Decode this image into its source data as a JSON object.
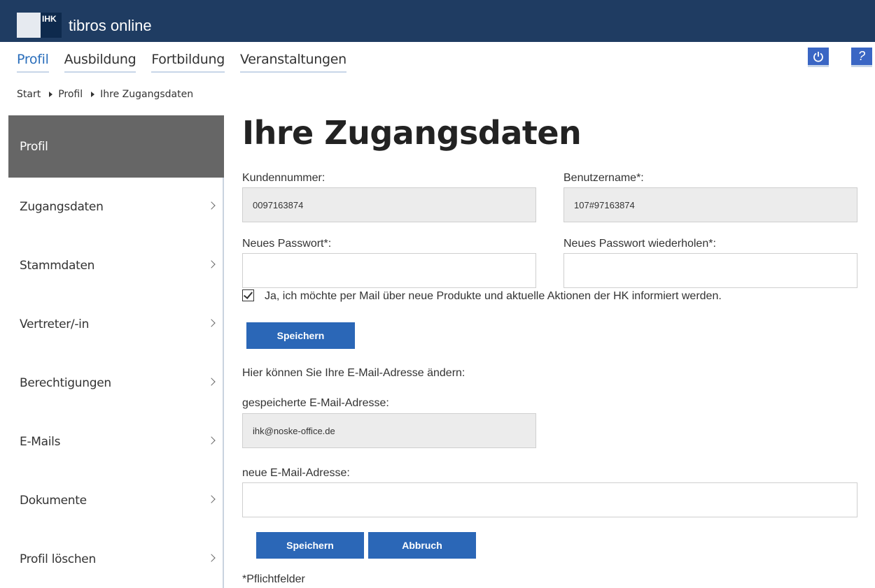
{
  "header": {
    "logo_text": "IHK",
    "app_title": "tibros online"
  },
  "nav": {
    "items": [
      {
        "label": "Profil",
        "active": true
      },
      {
        "label": "Ausbildung"
      },
      {
        "label": "Fortbildung"
      },
      {
        "label": "Veranstaltungen"
      }
    ],
    "help_label": "?"
  },
  "breadcrumb": [
    "Start",
    "Profil",
    "Ihre Zugangsdaten"
  ],
  "sidebar": {
    "items": [
      {
        "label": "Profil",
        "active": true
      },
      {
        "label": "Zugangsdaten"
      },
      {
        "label": "Stammdaten"
      },
      {
        "label": "Vertreter/-in"
      },
      {
        "label": "Berechtigungen"
      },
      {
        "label": "E-Mails"
      },
      {
        "label": "Dokumente"
      },
      {
        "label": "Profil löschen"
      }
    ]
  },
  "content": {
    "title": "Ihre Zugangsdaten",
    "kundennummer_label": "Kundennummer:",
    "kundennummer_value": "0097163874",
    "benutzername_label": "Benutzername*:",
    "benutzername_value": "107#97163874",
    "password_label": "Neues Passwort*:",
    "password_value": "",
    "password_repeat_label": "Neues Passwort wiederholen*:",
    "password_repeat_value": "",
    "newsletter_checked": true,
    "newsletter_label": "Ja, ich möchte per Mail über neue Produkte und aktuelle Aktionen der HK informiert werden.",
    "save_label_1": "Speichern",
    "email_intro": "Hier können Sie Ihre E-Mail-Adresse ändern:",
    "stored_email_label": "gespeicherte E-Mail-Adresse:",
    "stored_email_value": "ihk@noske-office.de",
    "new_email_label": "neue E-Mail-Adresse:",
    "new_email_value": "",
    "save_label_2": "Speichern",
    "cancel_label": "Abbruch",
    "required_note": "*Pflichtfelder"
  },
  "colors": {
    "topbar": "#1f3c62",
    "accent": "#2b67b7",
    "sidebar_active": "#666666"
  }
}
